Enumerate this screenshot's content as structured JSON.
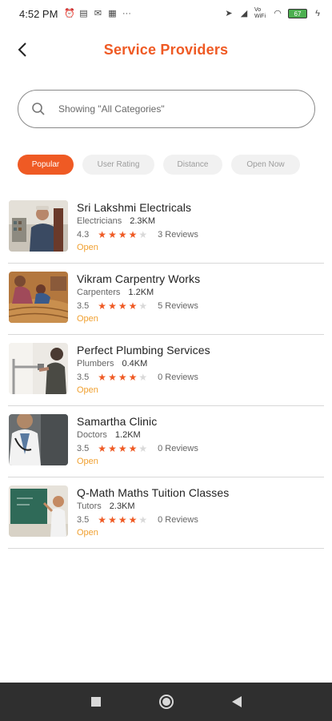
{
  "status_bar": {
    "time": "4:52 PM",
    "network_label": "Vo WiFi",
    "battery_level": "67"
  },
  "header": {
    "title": "Service Providers"
  },
  "search": {
    "placeholder": "Showing \"All Categories\""
  },
  "filters": [
    {
      "label": "Popular",
      "active": true
    },
    {
      "label": "User Rating",
      "active": false
    },
    {
      "label": "Distance",
      "active": false
    },
    {
      "label": "Open Now",
      "active": false
    }
  ],
  "providers": [
    {
      "name": "Sri Lakshmi Electricals",
      "category": "Electricians",
      "distance": "2.3KM",
      "rating": "4.3",
      "stars": 4,
      "reviews": "3 Reviews",
      "status": "Open"
    },
    {
      "name": "Vikram Carpentry Works",
      "category": "Carpenters",
      "distance": "1.2KM",
      "rating": "3.5",
      "stars": 4,
      "reviews": "5 Reviews",
      "status": "Open"
    },
    {
      "name": "Perfect Plumbing Services",
      "category": "Plumbers",
      "distance": "0.4KM",
      "rating": "3.5",
      "stars": 4,
      "reviews": "0 Reviews",
      "status": "Open"
    },
    {
      "name": "Samartha Clinic",
      "category": "Doctors",
      "distance": "1.2KM",
      "rating": "3.5",
      "stars": 4,
      "reviews": "0 Reviews",
      "status": "Open"
    },
    {
      "name": "Q-Math Maths Tuition Classes",
      "category": "Tutors",
      "distance": "2.3KM",
      "rating": "3.5",
      "stars": 4,
      "reviews": "0 Reviews",
      "status": "Open"
    }
  ],
  "colors": {
    "accent": "#ef5a24",
    "open_status": "#f0a030",
    "nav_bar": "#2f2f2f"
  }
}
